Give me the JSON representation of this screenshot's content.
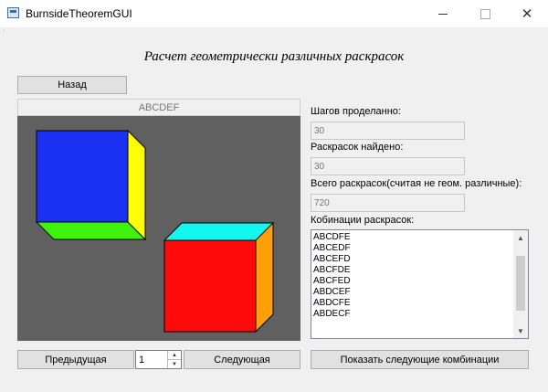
{
  "window": {
    "title": "BurnsideTheoremGUI"
  },
  "heading": "Расчет геометрически различных раскрасок",
  "back_button": "Назад",
  "canvas": {
    "header": "ABCDEF"
  },
  "cubes": [
    {
      "front": "#1a30f2",
      "right": "#ffff00",
      "bottom": "#3ff20c"
    },
    {
      "front": "#ff0a0a",
      "right": "#ff9f0a",
      "top": "#14f7ee"
    }
  ],
  "stats": {
    "steps_label": "Шагов проделанно:",
    "steps_value": "30",
    "found_label": "Раскрасок найдено:",
    "found_value": "30",
    "total_label": "Всего раскрасок(считая не геом. различные):",
    "total_value": "720",
    "combos_label": "Кобинации раскрасок:"
  },
  "combinations": [
    "ABCDFE",
    "ABCEDF",
    "ABCEFD",
    "ABCFDE",
    "ABCFED",
    "ABDCEF",
    "ABDCFE",
    "ABDECF"
  ],
  "controls": {
    "prev": "Предыдущая",
    "spin_value": "1",
    "next": "Следующая",
    "show_next": "Показать следующие комбинации"
  }
}
